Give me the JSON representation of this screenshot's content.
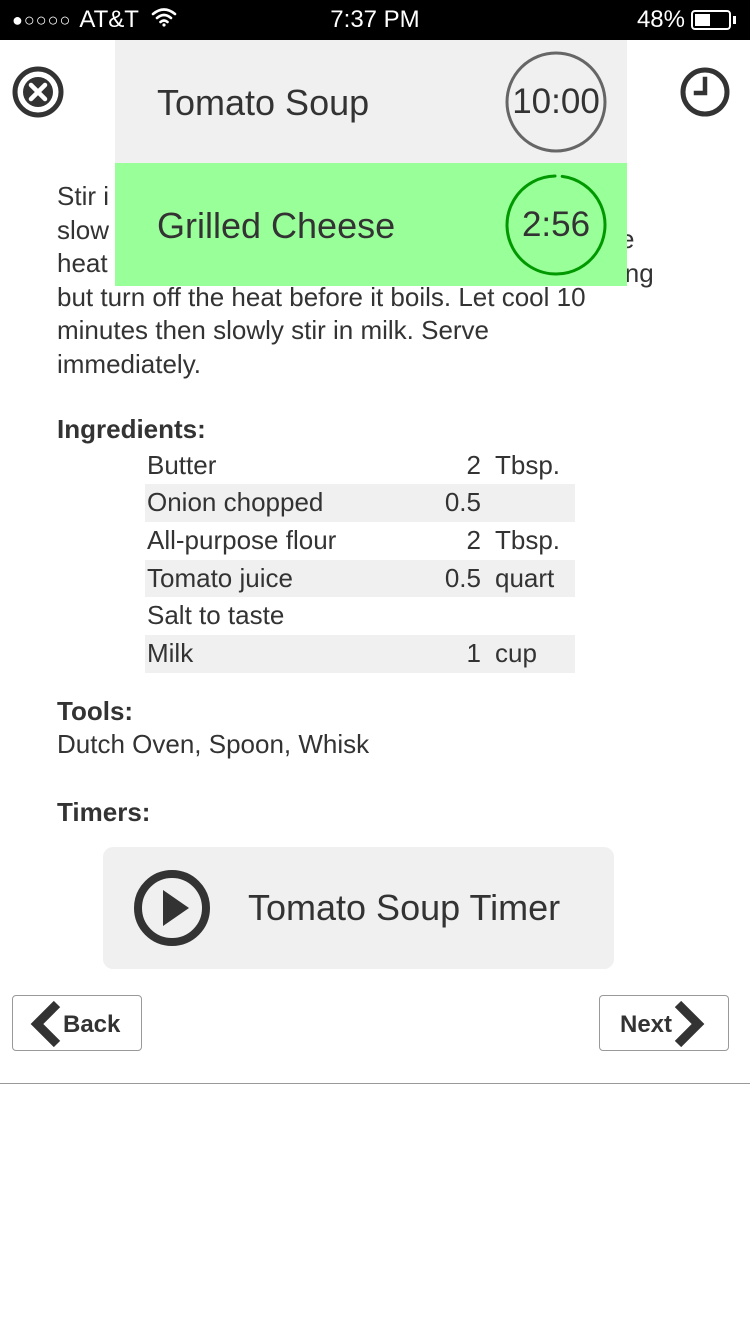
{
  "status_bar": {
    "signal": "●○○○○",
    "carrier": "AT&T",
    "time": "7:37 PM",
    "battery_percent": "48%",
    "battery_level": 0.48,
    "wifi_icon": "wifi-icon"
  },
  "toolbar": {
    "close_icon": "close-circle-icon",
    "timer_icon": "clock-icon"
  },
  "instructions": {
    "lines": [
      "Stir i",
      "slow",
      "heat",
      "but turn off the heat before it boils. Let cool 10",
      "minutes then slowly stir in milk. Serve",
      "immediately."
    ],
    "right_fragments": [
      "e",
      "ing"
    ]
  },
  "ingredients": {
    "heading": "Ingredients:",
    "rows": [
      {
        "name": "Butter",
        "qty": "2",
        "unit": "Tbsp."
      },
      {
        "name": "Onion chopped",
        "qty": "0.5",
        "unit": ""
      },
      {
        "name": "All-purpose flour",
        "qty": "2",
        "unit": "Tbsp."
      },
      {
        "name": "Tomato juice",
        "qty": "0.5",
        "unit": "quart"
      },
      {
        "name": "Salt to taste",
        "qty": "",
        "unit": ""
      },
      {
        "name": "Milk",
        "qty": "1",
        "unit": "cup"
      }
    ]
  },
  "tools": {
    "heading": "Tools:",
    "list": "Dutch Oven, Spoon, Whisk"
  },
  "timers_section": {
    "heading": "Timers:",
    "button_label": "Tomato Soup Timer",
    "play_icon": "play-circle-icon"
  },
  "nav": {
    "back_label": "Back",
    "next_label": "Next"
  },
  "active_timers": [
    {
      "name": "Tomato Soup",
      "time": "10:00",
      "progress": 1.0,
      "active": false,
      "bg": "#f0f0f0",
      "ring_color": "#666666"
    },
    {
      "name": "Grilled Cheese",
      "time": "2:56",
      "progress": 0.98,
      "active": true,
      "bg": "#99ff99",
      "ring_color": "#009900"
    }
  ]
}
